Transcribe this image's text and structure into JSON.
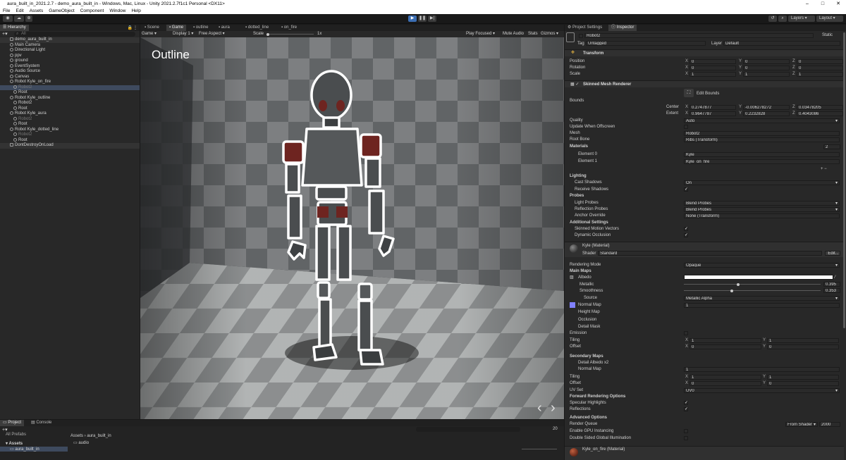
{
  "window": {
    "title": "aura_built_in_2021.2.7 - demo_aura_built_in - Windows, Mac, Linux - Unity 2021.2.7f1c1 Personal <DX11>",
    "buttons": [
      "–",
      "□",
      "✕"
    ]
  },
  "menu": [
    "File",
    "Edit",
    "Assets",
    "GameObject",
    "Component",
    "Window",
    "Help"
  ],
  "toolbar": {
    "layers_label": "Layers",
    "layout_label": "Layout"
  },
  "hierarchy": {
    "tab_label": "Hierarchy",
    "search_placeholder": "All",
    "rows": [
      {
        "label": "demo_aura_built_in",
        "indent": 0,
        "type": "scene",
        "selected": false
      },
      {
        "label": "Main Camera",
        "indent": 2,
        "type": "go"
      },
      {
        "label": "Directional Light",
        "indent": 2,
        "type": "go"
      },
      {
        "label": "ppv",
        "indent": 2,
        "type": "go"
      },
      {
        "label": "ground",
        "indent": 2,
        "type": "go"
      },
      {
        "label": "EventSystem",
        "indent": 2,
        "type": "go"
      },
      {
        "label": "Audio Source",
        "indent": 2,
        "type": "go"
      },
      {
        "label": "Canvas",
        "indent": 2,
        "type": "go"
      },
      {
        "label": "Robot Kyle_on_fire",
        "indent": 2,
        "type": "go"
      },
      {
        "label": "Robot2",
        "indent": 3,
        "type": "go",
        "selected": true,
        "dim": true
      },
      {
        "label": "Root",
        "indent": 3,
        "type": "go"
      },
      {
        "label": "Robot Kyle_outline",
        "indent": 2,
        "type": "go"
      },
      {
        "label": "Robot2",
        "indent": 3,
        "type": "go"
      },
      {
        "label": "Root",
        "indent": 3,
        "type": "go"
      },
      {
        "label": "Robot Kyle_aura",
        "indent": 2,
        "type": "go"
      },
      {
        "label": "Robot2",
        "indent": 3,
        "type": "go",
        "dim": true
      },
      {
        "label": "Root",
        "indent": 3,
        "type": "go"
      },
      {
        "label": "Robot Kyle_dotted_line",
        "indent": 2,
        "type": "go"
      },
      {
        "label": "Robot2",
        "indent": 3,
        "type": "go",
        "dim": true
      },
      {
        "label": "Root",
        "indent": 3,
        "type": "go"
      },
      {
        "label": "DontDestroyOnLoad",
        "indent": 0,
        "type": "scene",
        "selected": false
      }
    ]
  },
  "center_tabs": [
    "Scene",
    "Game",
    "outline",
    "aura",
    "dotted_line",
    "on_fire"
  ],
  "game_bar": {
    "display_mode": "Game",
    "display": "Display 1",
    "aspect": "Free Aspect",
    "scale_label": "Scale",
    "scale_value": "1x",
    "play_focused": "Play Focused",
    "mute_audio": "Mute Audio",
    "stats": "Stats",
    "gizmos": "Gizmos"
  },
  "game_view": {
    "overlay_title": "Outline",
    "nav_prev": "‹",
    "nav_next": "›"
  },
  "bottom": {
    "tabs": [
      "Project",
      "Console"
    ],
    "tree": [
      "All Prefabs",
      "Assets",
      "aura_built_in"
    ],
    "breadcrumb": [
      "Assets",
      "aura_built_in"
    ],
    "folder": "audio",
    "count": "20"
  },
  "inspector": {
    "tabs": [
      "Project Settings",
      "Inspector"
    ],
    "object_name": "Robot2",
    "static_label": "Static",
    "tag_label": "Tag",
    "tag_value": "Untagged",
    "layer_label": "Layer",
    "layer_value": "Default",
    "transform": {
      "header": "Transform",
      "position_label": "Position",
      "position": [
        "0",
        "0",
        "0"
      ],
      "rotation_label": "Rotation",
      "rotation": [
        "0",
        "0",
        "0"
      ],
      "scale_label": "Scale",
      "scale": [
        "1",
        "1",
        "1"
      ]
    },
    "smr": {
      "header": "Skinned Mesh Renderer",
      "edit_bounds": "Edit Bounds",
      "bounds_label": "Bounds",
      "center_label": "Center",
      "center": [
        "0.2747877",
        "-0.006278272",
        "0.03478205"
      ],
      "extent_label": "Extent",
      "extent": [
        "0.9647787",
        "0.2232828",
        "0.4043086"
      ],
      "quality_label": "Quality",
      "quality_value": "Auto",
      "update_offscreen_label": "Update When Offscreen",
      "mesh_label": "Mesh",
      "mesh_value": "Robot2",
      "root_bone_label": "Root Bone",
      "root_bone_value": "Ribs (Transform)",
      "materials_label": "Materials",
      "materials_count": "2",
      "element0_label": "Element 0",
      "element0_value": "Kyle",
      "element1_label": "Element 1",
      "element1_value": "Kyle_on_fire",
      "lighting_label": "Lighting",
      "cast_shadows_label": "Cast Shadows",
      "cast_shadows_value": "On",
      "receive_shadows_label": "Receive Shadows",
      "probes_label": "Probes",
      "light_probes_label": "Light Probes",
      "light_probes_value": "Blend Probes",
      "reflection_probes_label": "Reflection Probes",
      "reflection_probes_value": "Blend Probes",
      "anchor_override_label": "Anchor Override",
      "anchor_override_value": "None (Transform)",
      "additional_label": "Additional Settings",
      "skinned_motion_label": "Skinned Motion Vectors",
      "dynamic_occlusion_label": "Dynamic Occlusion"
    },
    "material": {
      "name": "Kyle (Material)",
      "shader_label": "Shader",
      "shader_value": "Standard",
      "edit_label": "Edit...",
      "rendering_mode_label": "Rendering Mode",
      "rendering_mode_value": "Opaque",
      "main_maps_label": "Main Maps",
      "albedo_label": "Albedo",
      "metallic_label": "Metallic",
      "metallic_value": "0.395",
      "metallic_fraction": 0.395,
      "smoothness_label": "Smoothness",
      "smoothness_value": "0.353",
      "smoothness_fraction": 0.353,
      "source_label": "Source",
      "source_value": "Metallic Alpha",
      "normal_map_label": "Normal Map",
      "normal_map_value": "1",
      "height_map_label": "Height Map",
      "occlusion_label": "Occlusion",
      "detail_mask_label": "Detail Mask",
      "emission_label": "Emission",
      "tiling_label": "Tiling",
      "tiling": [
        "1",
        "1"
      ],
      "offset_label": "Offset",
      "offset": [
        "0",
        "0"
      ],
      "secondary_maps_label": "Secondary Maps",
      "detail_albedo_label": "Detail Albedo x2",
      "normal_map2_label": "Normal Map",
      "normal_map2_value": "1",
      "tiling2": [
        "1",
        "1"
      ],
      "offset2": [
        "0",
        "0"
      ],
      "uv_set_label": "UV Set",
      "uv_set_value": "UV0",
      "forward_label": "Forward Rendering Options",
      "specular_label": "Specular Highlights",
      "reflections_label": "Reflections",
      "advanced_label": "Advanced Options",
      "render_queue_label": "Render Queue",
      "render_queue_mode": "From Shader",
      "render_queue_value": "2000",
      "gpu_instancing_label": "Enable GPU Instancing",
      "double_sided_label": "Double Sided Global Illumination",
      "next_material": "Kyle_on_fire (Material)"
    }
  },
  "colors": {
    "accent": "#3b6eb3",
    "panel": "#282828",
    "outline": "#ffffff",
    "robot_body": "#4a4d4f",
    "robot_red": "#6e2420"
  }
}
